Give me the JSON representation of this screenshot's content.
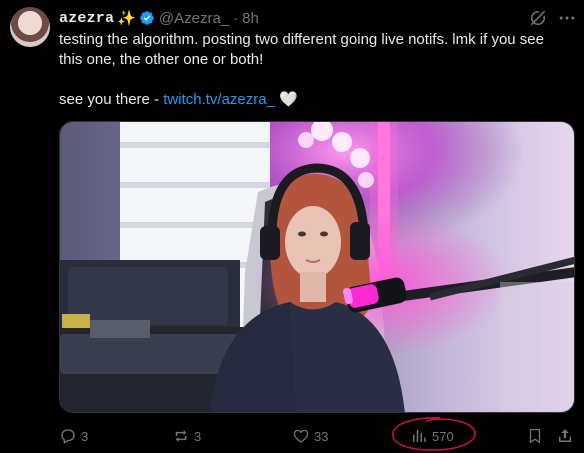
{
  "post": {
    "display_name": "azezra",
    "name_emoji": "✨",
    "handle": "@Azezra_",
    "separator": "·",
    "time": "8h",
    "text_line1": "testing the algorithm. posting two different going live notifs. lmk if you see",
    "text_line2": "this one, the other one or both!",
    "text_line3_prefix": "see you there - ",
    "link_text": "twitch.tv/azezra_",
    "heart_emoji": "🤍"
  },
  "actions": {
    "replies": "3",
    "reposts": "3",
    "likes": "33",
    "views": "570"
  },
  "icons": {
    "verified": "verified-badge-icon",
    "grok": "grok-icon",
    "more": "more-icon",
    "reply": "reply-icon",
    "repost": "repost-icon",
    "like": "heart-icon",
    "views": "views-icon",
    "bookmark": "bookmark-icon",
    "share": "share-icon"
  },
  "colors": {
    "background": "#000000",
    "text": "#e7e9ea",
    "muted": "#71767b",
    "link": "#1d9bf0",
    "annotation": "#c0124a"
  }
}
